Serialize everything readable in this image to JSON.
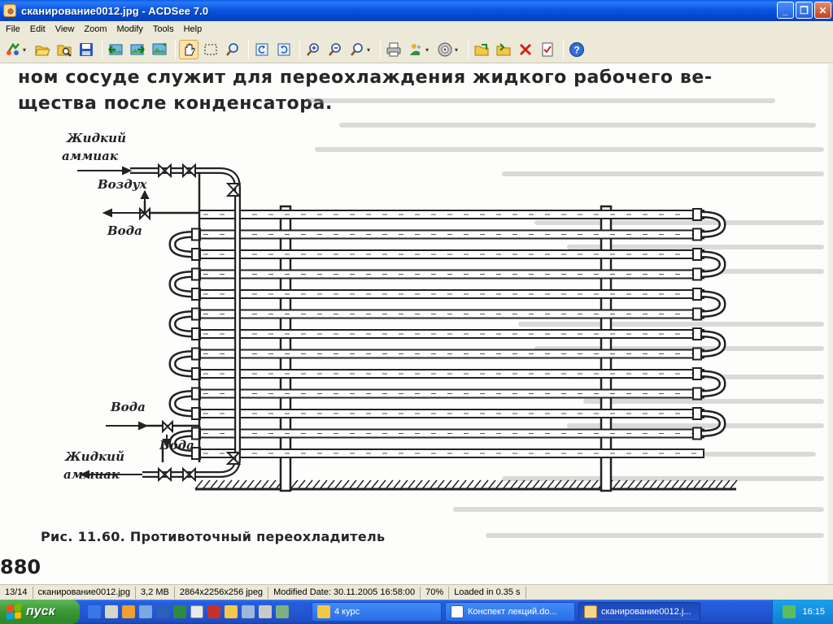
{
  "window": {
    "title": "сканирование0012.jpg - ACDSee 7.0",
    "buttons": [
      "_",
      "❐",
      "✕"
    ]
  },
  "menu": [
    "File",
    "Edit",
    "View",
    "Zoom",
    "Modify",
    "Tools",
    "Help"
  ],
  "toolbar": {
    "buttons": [
      "acquire",
      "open-folder",
      "browse",
      "save",
      "prev-image",
      "next-image",
      "slideshow",
      "pan",
      "select",
      "zoom-tool",
      "rotate-left",
      "rotate-right",
      "zoom-in",
      "zoom-out",
      "zoom-menu",
      "print",
      "wallpaper",
      "email",
      "copy-to",
      "move-to",
      "delete",
      "properties",
      "help"
    ],
    "active": "pan"
  },
  "page": {
    "line1": "ном сосуде служит для переохлаждения жидкого рабочего ве-",
    "line2": "щества после конденсатора.",
    "caption": "Рис. 11.60. Противоточный переохладитель",
    "page_number": "880",
    "labels": {
      "liquid_ammonia_top_1": "Жидкий",
      "liquid_ammonia_top_2": "аммиак",
      "air": "Воздух",
      "water_top": "Вода",
      "water_in": "Вода",
      "water_bottom": "Вода",
      "liquid_ammonia_bottom_1": "Жидкий",
      "liquid_ammonia_bottom_2": "аммиак"
    }
  },
  "status": {
    "index": "13/14",
    "filename": "сканирование0012.jpg",
    "size": "3,2 MB",
    "dimensions": "2864x2256x256 jpeg",
    "modified": "Modified Date: 30.11.2005 16:58:00",
    "zoom": "70%",
    "loaded": "Loaded in 0.35 s"
  },
  "taskbar": {
    "start": "пуск",
    "tasks": [
      {
        "label": "4 курс",
        "icon": "folder-icon"
      },
      {
        "label": "Конспект лекций.do...",
        "icon": "word-icon"
      },
      {
        "label": "сканирование0012.j...",
        "icon": "acdsee-icon"
      }
    ],
    "active_task": 2,
    "clock": "16:15"
  },
  "colors": {
    "title_bar": "#0b56e0",
    "taskbar": "#245ddb",
    "start": "#3c9a36",
    "ink": "#262626"
  }
}
